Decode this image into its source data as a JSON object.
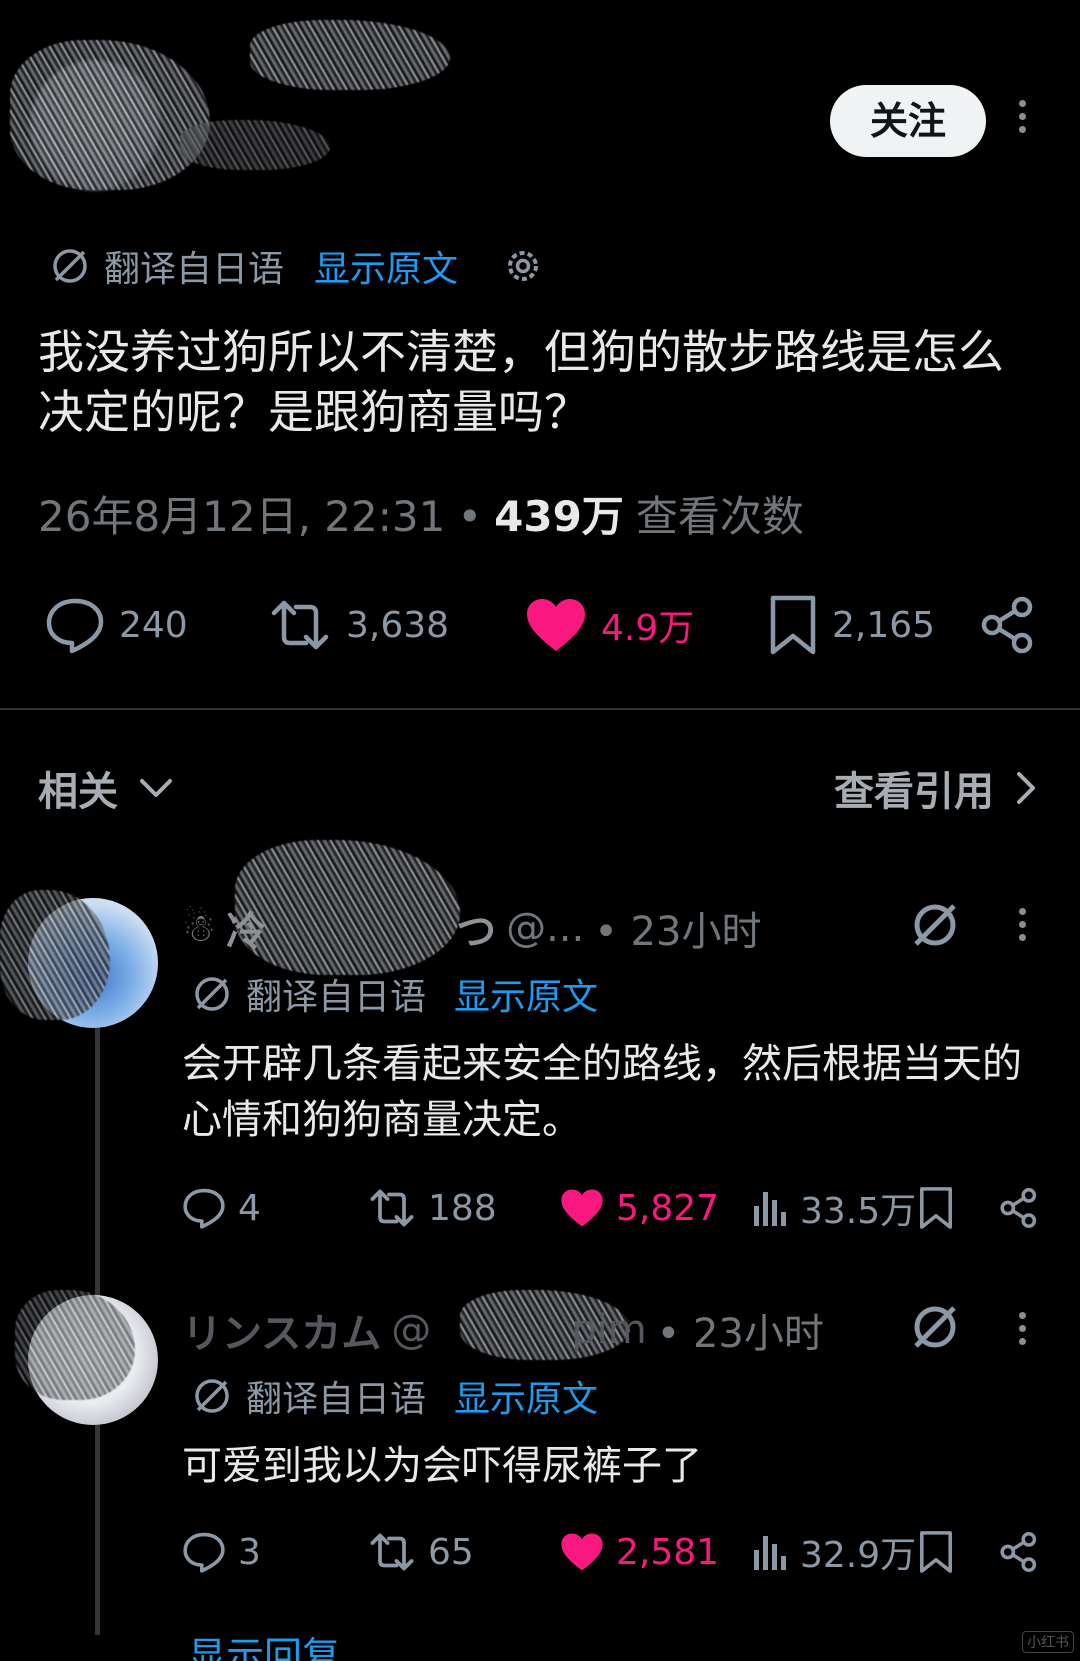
{
  "header": {
    "follow_label": "关注"
  },
  "tweet": {
    "translated_from": "翻译自日语",
    "show_original": "显示原文",
    "text": "我没养过狗所以不清楚，但狗的散步路线是怎么决定的呢？是跟狗商量吗？",
    "datetime": "26年8月12日, 22:31",
    "separator": "•",
    "views_count": "439万",
    "views_label": "查看次数",
    "replies": "240",
    "reposts": "3,638",
    "likes": "4.9万",
    "bookmarks": "2,165"
  },
  "related": {
    "label": "相关",
    "quotes_link": "查看引用"
  },
  "replies": [
    {
      "name_visible": "冷",
      "name_tail": "つ",
      "handle_visible": "@...",
      "time": "• 23小时",
      "translated_from": "翻译自日语",
      "show_original": "显示原文",
      "text": "会开辟几条看起来安全的路线，然后根据当天的心情和狗狗商量决定。",
      "replies": "4",
      "reposts": "188",
      "likes": "5,827",
      "views": "33.5万"
    },
    {
      "name_visible": "リンスカム",
      "handle_visible": "@",
      "handle_tail": "pim",
      "time": "• 23小时",
      "translated_from": "翻译自日语",
      "show_original": "显示原文",
      "text": "可爱到我以为会吓得尿裤子了",
      "replies": "3",
      "reposts": "65",
      "likes": "2,581",
      "views": "32.9万"
    }
  ],
  "footer": {
    "show_replies": "显示回复"
  },
  "colors": {
    "background": "#000000",
    "text": "#e7e9ea",
    "muted": "#71767b",
    "link": "#1d9bf0",
    "like": "#f91880",
    "divider": "#2f3336"
  },
  "icons": [
    "translate-icon",
    "gear-icon",
    "reply-icon",
    "repost-icon",
    "heart-icon",
    "bookmark-icon",
    "share-icon",
    "views-icon",
    "grok-icon",
    "chevron-down-icon",
    "chevron-right-icon",
    "more-icon"
  ]
}
